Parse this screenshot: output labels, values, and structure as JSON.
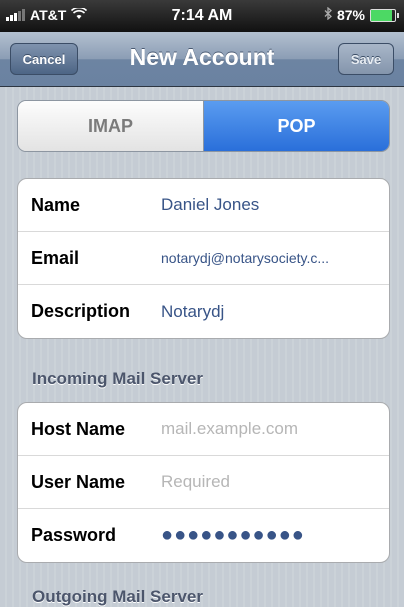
{
  "status_bar": {
    "carrier": "AT&T",
    "time": "7:14 AM",
    "battery_percent": "87%",
    "battery_level": 0.87
  },
  "nav": {
    "cancel_label": "Cancel",
    "title": "New Account",
    "save_label": "Save"
  },
  "segmented": {
    "options": [
      "IMAP",
      "POP"
    ],
    "selected": "POP"
  },
  "account": {
    "rows": [
      {
        "label": "Name",
        "value": "Daniel Jones"
      },
      {
        "label": "Email",
        "value": "notarydj@notarysociety.c..."
      },
      {
        "label": "Description",
        "value": "Notarydj"
      }
    ]
  },
  "incoming": {
    "header": "Incoming Mail Server",
    "rows": [
      {
        "label": "Host Name",
        "placeholder": "mail.example.com"
      },
      {
        "label": "User Name",
        "placeholder": "Required"
      },
      {
        "label": "Password",
        "value": "●●●●●●●●●●●"
      }
    ]
  },
  "outgoing": {
    "header": "Outgoing Mail Server"
  }
}
